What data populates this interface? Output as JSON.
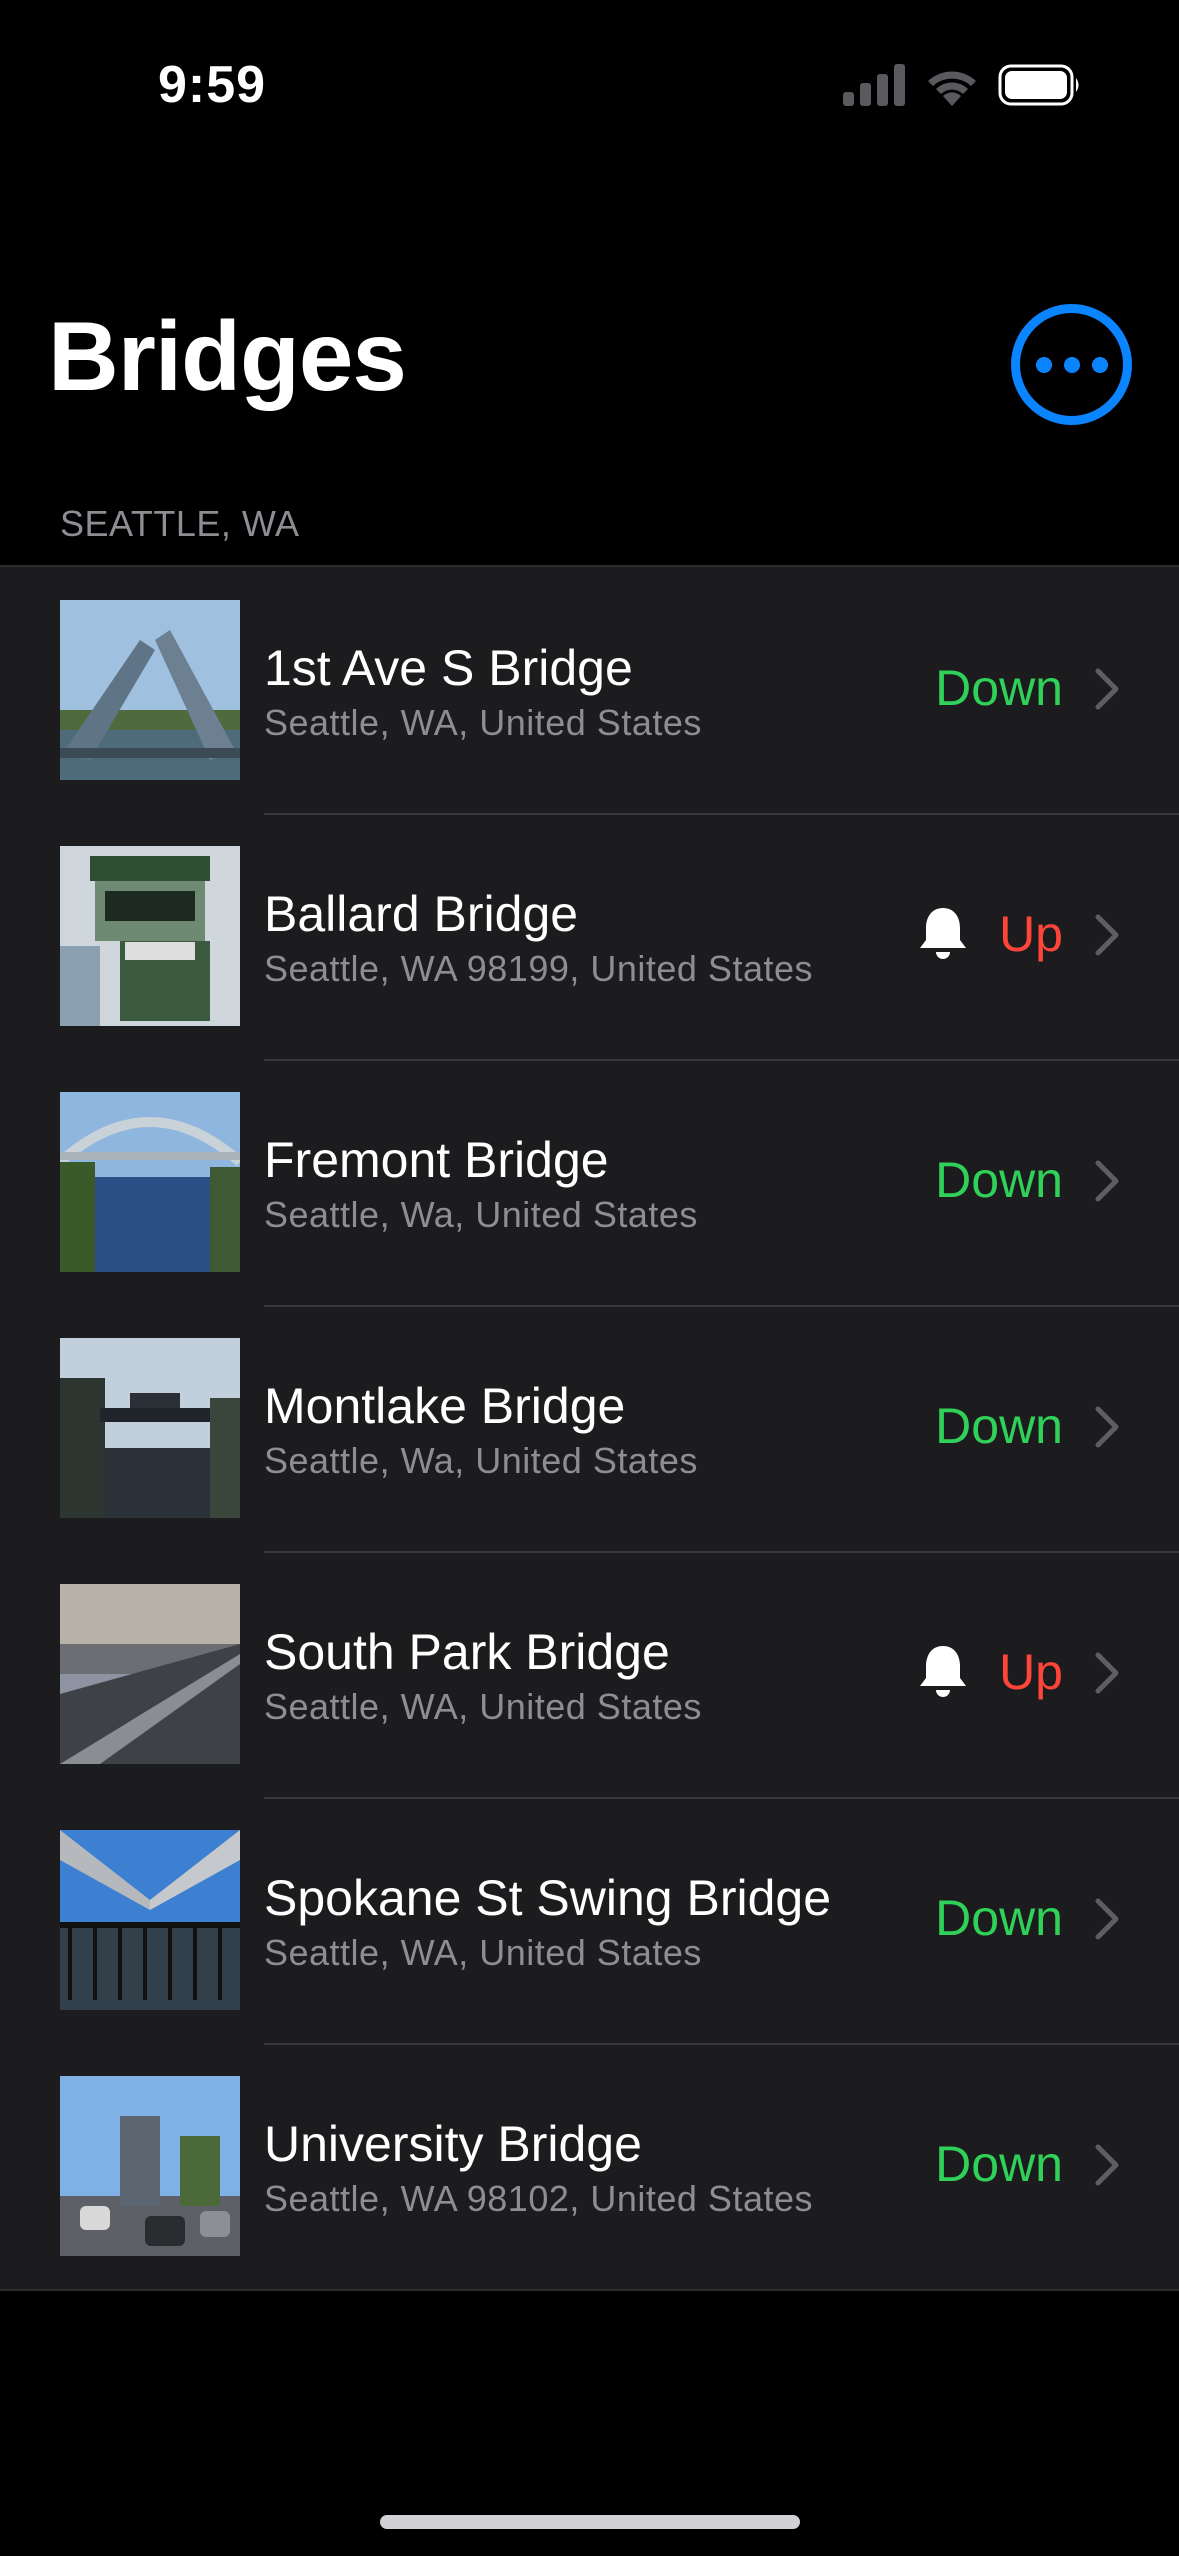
{
  "status_bar": {
    "time": "9:59",
    "icons": [
      "signal-icon",
      "wifi-icon",
      "battery-icon"
    ]
  },
  "header": {
    "title": "Bridges",
    "more_icon": "ellipsis-circle-icon"
  },
  "section": {
    "title": "SEATTLE, WA"
  },
  "colors": {
    "accent": "#0a84ff",
    "down": "#30d158",
    "up": "#ff453a",
    "background": "#000000",
    "cell": "#1c1c1e",
    "secondary_text": "#8d8d93"
  },
  "bridges": [
    {
      "name": "1st Ave S Bridge",
      "location": "Seattle, WA, United States",
      "status": "Down",
      "notify": false
    },
    {
      "name": "Ballard Bridge",
      "location": "Seattle, WA 98199, United States",
      "status": "Up",
      "notify": true
    },
    {
      "name": "Fremont Bridge",
      "location": "Seattle, Wa, United States",
      "status": "Down",
      "notify": false
    },
    {
      "name": "Montlake Bridge",
      "location": "Seattle, Wa, United States",
      "status": "Down",
      "notify": false
    },
    {
      "name": "South Park Bridge",
      "location": "Seattle, WA, United States",
      "status": "Up",
      "notify": true
    },
    {
      "name": "Spokane St Swing Bridge",
      "location": "Seattle, WA, United States",
      "status": "Down",
      "notify": false
    },
    {
      "name": "University Bridge",
      "location": "Seattle, WA  98102, United States",
      "status": "Down",
      "notify": false
    }
  ]
}
